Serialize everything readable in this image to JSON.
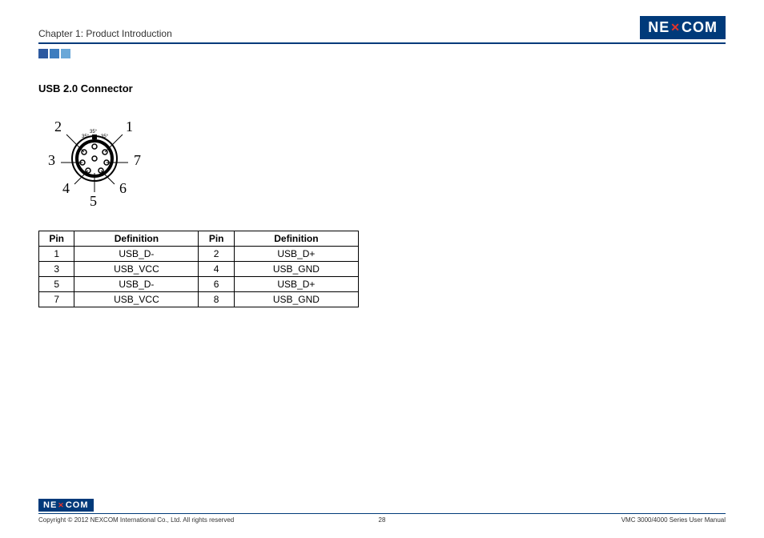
{
  "header": {
    "chapter_title": "Chapter 1: Product Introduction",
    "logo_text_pre": "NE",
    "logo_text_x": "✕",
    "logo_text_post": "COM"
  },
  "section": {
    "title": "USB 2.0 Connector"
  },
  "diagram": {
    "pin_labels": [
      "1",
      "2",
      "3",
      "4",
      "5",
      "6",
      "7"
    ]
  },
  "table": {
    "headers": [
      "Pin",
      "Definition",
      "Pin",
      "Definition"
    ],
    "rows": [
      {
        "p1": "1",
        "d1": "USB_D-",
        "p2": "2",
        "d2": "USB_D+"
      },
      {
        "p1": "3",
        "d1": "USB_VCC",
        "p2": "4",
        "d2": "USB_GND"
      },
      {
        "p1": "5",
        "d1": "USB_D-",
        "p2": "6",
        "d2": "USB_D+"
      },
      {
        "p1": "7",
        "d1": "USB_VCC",
        "p2": "8",
        "d2": "USB_GND"
      }
    ]
  },
  "footer": {
    "copyright": "Copyright © 2012 NEXCOM International Co., Ltd. All rights reserved",
    "page": "28",
    "manual": "VMC 3000/4000 Series User Manual"
  }
}
